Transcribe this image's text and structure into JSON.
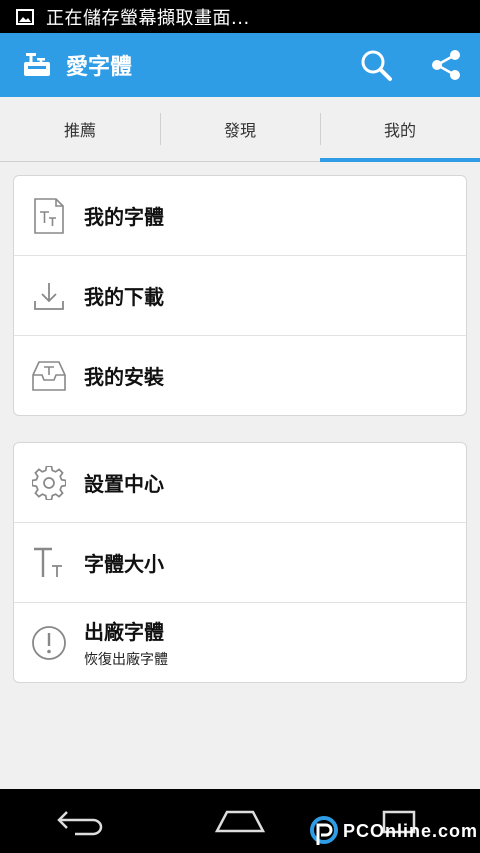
{
  "status_bar": {
    "notification_text": "正在儲存螢幕擷取畫面...",
    "icon": "image-icon"
  },
  "app_bar": {
    "title": "愛字體",
    "logo_icon": "font-app-logo-icon",
    "actions": [
      {
        "name": "search",
        "icon": "search-icon"
      },
      {
        "name": "share",
        "icon": "share-icon"
      }
    ],
    "color": "#2f9ce6"
  },
  "tabs": [
    {
      "label": "推薦",
      "active": false
    },
    {
      "label": "發現",
      "active": false
    },
    {
      "label": "我的",
      "active": true
    }
  ],
  "group1": [
    {
      "label": "我的字體",
      "icon": "font-file-icon"
    },
    {
      "label": "我的下載",
      "icon": "download-icon"
    },
    {
      "label": "我的安裝",
      "icon": "install-tray-icon"
    }
  ],
  "group2": [
    {
      "label": "設置中心",
      "icon": "gear-icon"
    },
    {
      "label": "字體大小",
      "icon": "font-size-icon"
    },
    {
      "label": "出廠字體",
      "sublabel": "恢復出廠字體",
      "icon": "info-icon"
    }
  ],
  "nav_bar": {
    "buttons": [
      {
        "name": "back",
        "icon": "back-icon"
      },
      {
        "name": "home",
        "icon": "home-icon"
      },
      {
        "name": "recents",
        "icon": "recents-icon"
      }
    ]
  },
  "watermark": {
    "text": "PCOnline.com"
  }
}
